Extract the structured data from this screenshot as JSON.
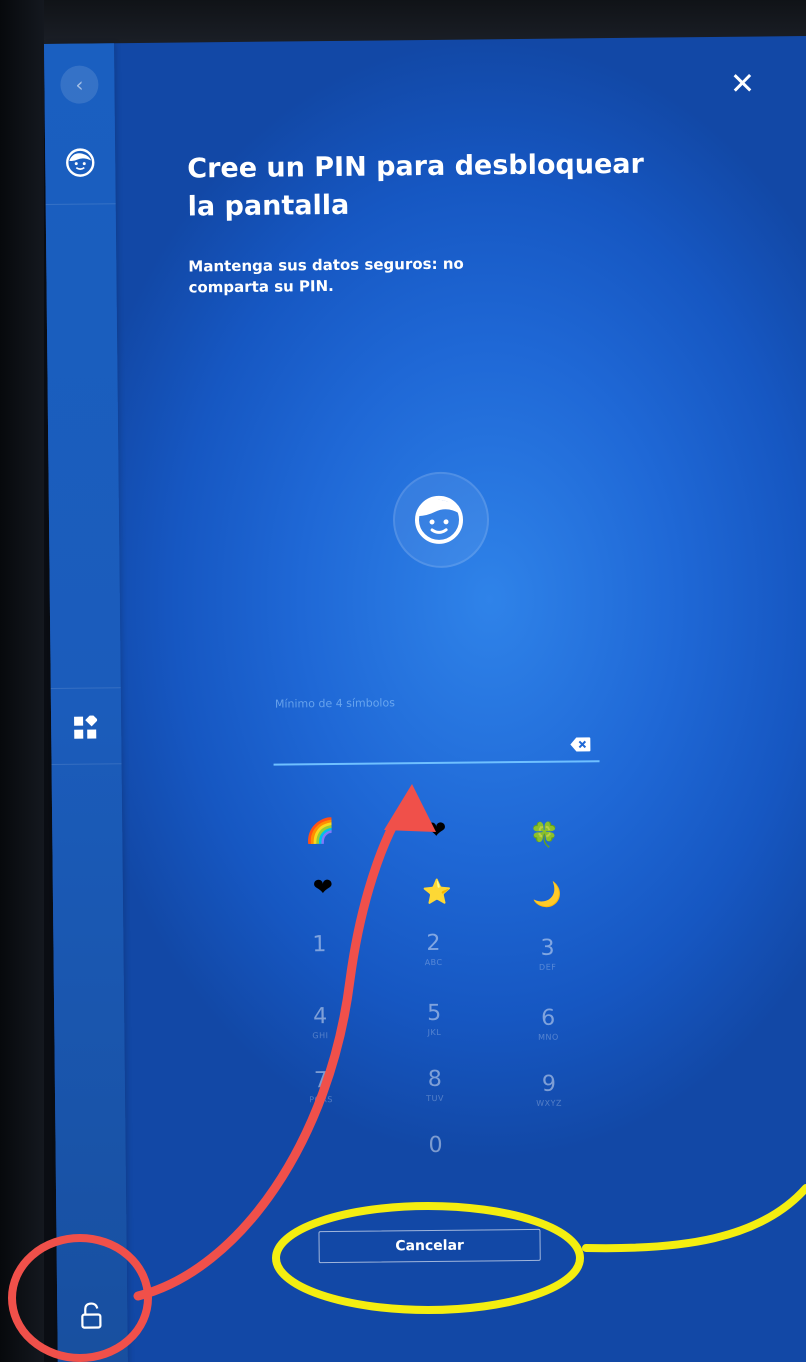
{
  "header": {
    "title": "Cree un PIN para desbloquear la pantalla",
    "subtitle": "Mantenga sus datos seguros: no comparta su PIN.",
    "close_label": "✕",
    "back_label": "‹"
  },
  "pin": {
    "hint": "Mínimo de 4 símbolos",
    "value": ""
  },
  "emojis": [
    "🌈",
    "❤",
    "🍀",
    "❤",
    "⭐",
    "🌙"
  ],
  "keypad": [
    {
      "num": "1",
      "letters": ""
    },
    {
      "num": "2",
      "letters": "ABC"
    },
    {
      "num": "3",
      "letters": "DEF"
    },
    {
      "num": "4",
      "letters": "GHI"
    },
    {
      "num": "5",
      "letters": "JKL"
    },
    {
      "num": "6",
      "letters": "MNO"
    },
    {
      "num": "7",
      "letters": "PQRS"
    },
    {
      "num": "8",
      "letters": "TUV"
    },
    {
      "num": "9",
      "letters": "WXYZ"
    },
    {
      "num": "0",
      "letters": ""
    }
  ],
  "footer": {
    "cancel_label": "Cancelar"
  },
  "colors": {
    "screen_blue": "#1f68d6",
    "input_line": "#6fc0ff",
    "annotation_red": "#f0504a",
    "annotation_yellow": "#f4ee10"
  }
}
